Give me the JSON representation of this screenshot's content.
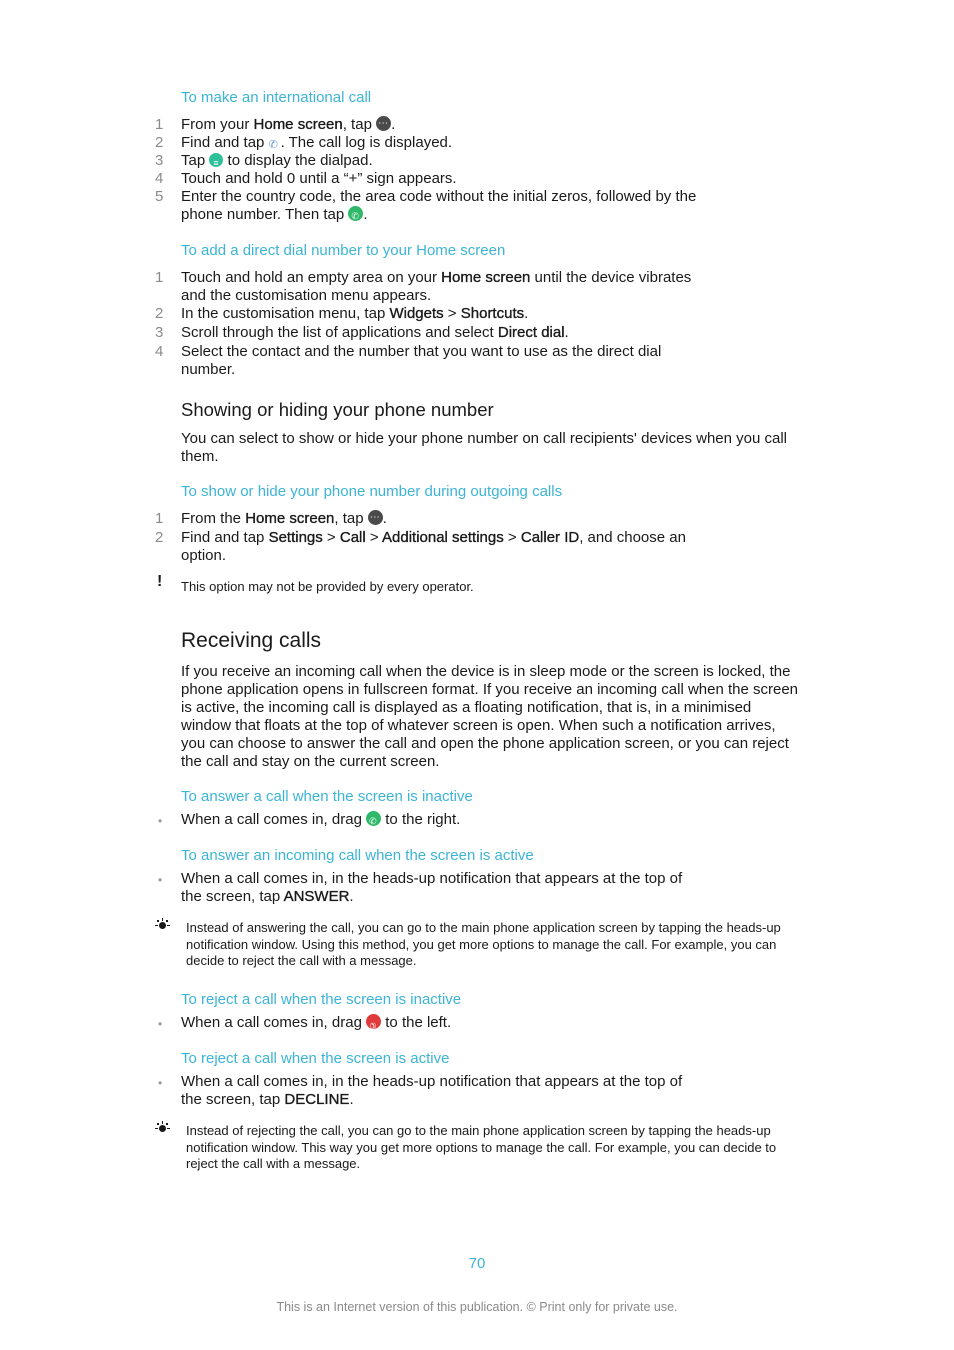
{
  "sections": {
    "international_call": {
      "heading": "To make an international call",
      "steps": [
        {
          "num": "1",
          "parts": [
            "From your ",
            "Home screen",
            ", tap ",
            "."
          ]
        },
        {
          "num": "2",
          "parts": [
            "Find and tap ",
            ". The call log is displayed."
          ]
        },
        {
          "num": "3",
          "parts": [
            "Tap ",
            " to display the dialpad."
          ]
        },
        {
          "num": "4",
          "parts": [
            "Touch and hold 0 until a “+” sign appears."
          ]
        },
        {
          "num": "5",
          "parts": [
            "Enter the country code, the area code without the initial zeros, followed by the",
            "phone number. Then tap ",
            "."
          ]
        }
      ]
    },
    "direct_dial": {
      "heading": "To add a direct dial number to your Home screen",
      "steps": [
        {
          "num": "1",
          "parts": [
            "Touch and hold an empty area on your ",
            "Home screen",
            " until the device vibrates",
            "and the customisation menu appears."
          ]
        },
        {
          "num": "2",
          "parts": [
            "In the customisation menu, tap ",
            "Widgets",
            " > ",
            "Shortcuts",
            "."
          ]
        },
        {
          "num": "3",
          "parts": [
            "Scroll through the list of applications and select ",
            "Direct dial",
            "."
          ]
        },
        {
          "num": "4",
          "parts": [
            "Select the contact and the number that you want to use as the direct dial",
            "number."
          ]
        }
      ]
    },
    "show_hide": {
      "title": "Showing or hiding your phone number",
      "intro": "You can select to show or hide your phone number on call recipients' devices when you call them.",
      "heading": "To show or hide your phone number during outgoing calls",
      "steps": [
        {
          "num": "1",
          "parts": [
            "From the ",
            "Home screen",
            ", tap ",
            "."
          ]
        },
        {
          "num": "2",
          "parts": [
            "Find and tap ",
            "Settings",
            " > ",
            "Call",
            " > ",
            "Additional settings",
            " > ",
            "Caller ID",
            ", and choose an",
            "option."
          ]
        }
      ],
      "note": "This option may not be provided by every operator."
    },
    "receiving": {
      "title": "Receiving calls",
      "intro": "If you receive an incoming call when the device is in sleep mode or the screen is locked, the phone application opens in fullscreen format. If you receive an incoming call when the screen is active, the incoming call is displayed as a floating notification, that is, in a minimised window that floats at the top of whatever screen is open. When such a notification arrives, you can choose to answer the call and open the phone application screen, or you can reject the call and stay on the current screen.",
      "answer_inactive": {
        "heading": "To answer a call when the screen is inactive",
        "bullet": [
          "When a call comes in, drag ",
          " to the right."
        ]
      },
      "answer_active": {
        "heading": "To answer an incoming call when the screen is active",
        "bullet": [
          "When a call comes in, in the heads-up notification that appears at the top of",
          "the screen, tap ",
          "ANSWER",
          "."
        ],
        "tip": "Instead of answering the call, you can go to the main phone application screen by tapping the heads-up notification window. Using this method, you get more options to manage the call. For example, you can decide to reject the call with a message."
      },
      "reject_inactive": {
        "heading": "To reject a call when the screen is inactive",
        "bullet": [
          "When a call comes in, drag ",
          " to the left."
        ]
      },
      "reject_active": {
        "heading": "To reject a call when the screen is active",
        "bullet": [
          "When a call comes in, in the heads-up notification that appears at the top of",
          "the screen, tap ",
          "DECLINE",
          "."
        ],
        "tip": "Instead of rejecting the call, you can go to the main phone application screen by tapping the heads-up notification window. This way you get more options to manage the call. For example, you can decide to reject the call with a message."
      }
    }
  },
  "bullet_char": "•",
  "warn_char": "!",
  "page_number": "70",
  "footer": "This is an Internet version of this publication. © Print only for private use.",
  "colors": {
    "accent": "#3cb4d6",
    "answer": "#2fb86a",
    "reject": "#e03a3a",
    "apps": "#4a4a4a"
  }
}
